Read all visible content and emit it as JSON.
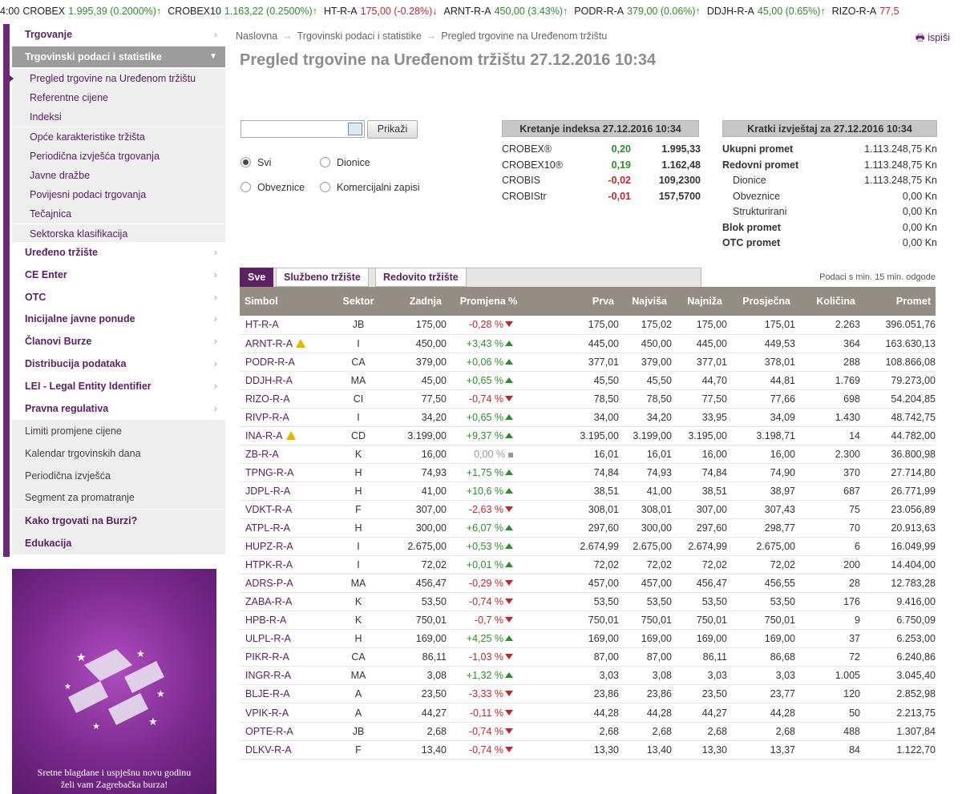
{
  "ticker": [
    {
      "text": "4:00",
      "cls": ""
    },
    {
      "text": "CROBEX",
      "cls": ""
    },
    {
      "text": "1.995,39 (0.2000%)↑",
      "cls": "up"
    },
    {
      "text": "CROBEX10",
      "cls": ""
    },
    {
      "text": "1.163,22 (0.2500%)↑",
      "cls": "up"
    },
    {
      "text": "HT-R-A",
      "cls": ""
    },
    {
      "text": "175,00 (-0.28%)↓",
      "cls": "dn"
    },
    {
      "text": "ARNT-R-A",
      "cls": ""
    },
    {
      "text": "450,00 (3.43%)↑",
      "cls": "up"
    },
    {
      "text": "PODR-R-A",
      "cls": ""
    },
    {
      "text": "379,00 (0.06%)↑",
      "cls": "up"
    },
    {
      "text": "DDJH-R-A",
      "cls": ""
    },
    {
      "text": "45,00 (0.65%)↑",
      "cls": "up"
    },
    {
      "text": "RIZO-R-A",
      "cls": ""
    },
    {
      "text": "77,5",
      "cls": "dn"
    }
  ],
  "sidebar": {
    "trgovanje": "Trgovanje",
    "podaci": "Trgovinski podaci i statistike",
    "subitems": [
      "Pregled trgovine na Uređenom tržištu",
      "Referentne cijene",
      "Indeksi",
      "Opće karakteristike tržišta",
      "Periodična izvješća trgovanja",
      "Javne dražbe",
      "Povijesni podaci trgovanja",
      "Tečajnica",
      "Sektorska klasifikacija"
    ],
    "items": [
      "Uređeno tržište",
      "CE Enter",
      "OTC",
      "Inicijalne javne ponude",
      "Članovi Burze",
      "Distribucija podataka",
      "LEI - Legal Entity Identifier",
      "Pravna regulativa"
    ],
    "plain": [
      "Limiti promjene cijene",
      "Kalendar trgovinskih dana",
      "Periodična izvješća",
      "Segment za promatranje"
    ],
    "bottom": [
      "Kako trgovati na Burzi?",
      "Edukacija"
    ],
    "promo_line1": "Sretne blagdane i uspješnu novu godinu",
    "promo_line2": "želi vam Zagrebačka burza!"
  },
  "breadcrumb": [
    "Naslovna",
    "Trgovinski podaci i statistike",
    "Pregled trgovine na Uređenom tržištu"
  ],
  "print_label": "ispiši",
  "title": "Pregled trgovine na Uređenom tržištu 27.12.2016 10:34",
  "form": {
    "date_value": "",
    "show_button": "Prikaži",
    "radios": [
      "Svi",
      "Dionice",
      "Obveznice",
      "Komercijalni zapisi"
    ]
  },
  "index_box": {
    "header": "Kretanje indeksa 27.12.2016 10:34",
    "rows": [
      {
        "name": "CROBEX®",
        "change": "0,20",
        "value": "1.995,33",
        "sign": "pos"
      },
      {
        "name": "CROBEX10®",
        "change": "0,19",
        "value": "1.162,48",
        "sign": "pos"
      },
      {
        "name": "CROBIS",
        "change": "-0,02",
        "value": "109,2300",
        "sign": "neg"
      },
      {
        "name": "CROBIStr",
        "change": "-0,01",
        "value": "157,5700",
        "sign": "neg"
      }
    ]
  },
  "report_box": {
    "header": "Kratki izvještaj za 27.12.2016 10:34",
    "rows": [
      {
        "label": "Ukupni promet",
        "value": "1.113.248,75 Kn",
        "style": "b"
      },
      {
        "label": "Redovni promet",
        "value": "1.113.248,75 Kn",
        "style": "b"
      },
      {
        "label": "Dionice",
        "value": "1.113.248,75 Kn",
        "style": "ind"
      },
      {
        "label": "Obveznice",
        "value": "0,00 Kn",
        "style": "ind"
      },
      {
        "label": "Strukturirani",
        "value": "0,00 Kn",
        "style": "ind"
      },
      {
        "label": "Blok promet",
        "value": "0,00 Kn",
        "style": "b"
      },
      {
        "label": "OTC promet",
        "value": "0,00 Kn",
        "style": "b"
      }
    ]
  },
  "tabs": [
    "Sve",
    "Službeno tržište",
    "Redovito tržište"
  ],
  "delay_note": "Podaci s min. 15 min. odgode",
  "table": {
    "headers": [
      "Simbol",
      "Sektor",
      "Zadnja",
      "Promjena %",
      "Prva",
      "Najviša",
      "Najniža",
      "Prosječna",
      "Količina",
      "Promet"
    ],
    "rows": [
      {
        "sym": "HT-R-A",
        "warn": false,
        "sec": "JB",
        "last": "175,00",
        "chg": "-0,28 %",
        "dir": "dn",
        "first": "175,00",
        "hi": "175,02",
        "lo": "175,00",
        "avg": "175,01",
        "qty": "2.263",
        "turn": "396.051,76"
      },
      {
        "sym": "ARNT-R-A",
        "warn": true,
        "sec": "I",
        "last": "450,00",
        "chg": "+3,43 %",
        "dir": "up",
        "first": "445,00",
        "hi": "450,00",
        "lo": "445,00",
        "avg": "449,53",
        "qty": "364",
        "turn": "163.630,13"
      },
      {
        "sym": "PODR-R-A",
        "warn": false,
        "sec": "CA",
        "last": "379,00",
        "chg": "+0,06 %",
        "dir": "up",
        "first": "377,01",
        "hi": "379,00",
        "lo": "377,01",
        "avg": "378,01",
        "qty": "288",
        "turn": "108.866,08"
      },
      {
        "sym": "DDJH-R-A",
        "warn": false,
        "sec": "MA",
        "last": "45,00",
        "chg": "+0,65 %",
        "dir": "up",
        "first": "45,50",
        "hi": "45,50",
        "lo": "44,70",
        "avg": "44,81",
        "qty": "1.769",
        "turn": "79.273,00"
      },
      {
        "sym": "RIZO-R-A",
        "warn": false,
        "sec": "CI",
        "last": "77,50",
        "chg": "-0,74 %",
        "dir": "dn",
        "first": "78,50",
        "hi": "78,50",
        "lo": "77,50",
        "avg": "77,66",
        "qty": "698",
        "turn": "54.204,85"
      },
      {
        "sym": "RIVP-R-A",
        "warn": false,
        "sec": "I",
        "last": "34,20",
        "chg": "+0,65 %",
        "dir": "up",
        "first": "34,00",
        "hi": "34,20",
        "lo": "33,95",
        "avg": "34,09",
        "qty": "1.430",
        "turn": "48.742,75"
      },
      {
        "sym": "INA-R-A",
        "warn": true,
        "sec": "CD",
        "last": "3.199,00",
        "chg": "+9,37 %",
        "dir": "up",
        "first": "3.195,00",
        "hi": "3.199,00",
        "lo": "3.195,00",
        "avg": "3.198,71",
        "qty": "14",
        "turn": "44.782,00"
      },
      {
        "sym": "ZB-R-A",
        "warn": false,
        "sec": "K",
        "last": "16,00",
        "chg": "0,00 %",
        "dir": "eq",
        "first": "16,01",
        "hi": "16,01",
        "lo": "16,00",
        "avg": "16,00",
        "qty": "2.300",
        "turn": "36.800,98"
      },
      {
        "sym": "TPNG-R-A",
        "warn": false,
        "sec": "H",
        "last": "74,93",
        "chg": "+1,75 %",
        "dir": "up",
        "first": "74,84",
        "hi": "74,93",
        "lo": "74,84",
        "avg": "74,90",
        "qty": "370",
        "turn": "27.714,80"
      },
      {
        "sym": "JDPL-R-A",
        "warn": false,
        "sec": "H",
        "last": "41,00",
        "chg": "+10,6 %",
        "dir": "up",
        "first": "38,51",
        "hi": "41,00",
        "lo": "38,51",
        "avg": "38,97",
        "qty": "687",
        "turn": "26.771,99"
      },
      {
        "sym": "VDKT-R-A",
        "warn": false,
        "sec": "F",
        "last": "307,00",
        "chg": "-2,63 %",
        "dir": "dn",
        "first": "308,01",
        "hi": "308,01",
        "lo": "307,00",
        "avg": "307,43",
        "qty": "75",
        "turn": "23.056,89"
      },
      {
        "sym": "ATPL-R-A",
        "warn": false,
        "sec": "H",
        "last": "300,00",
        "chg": "+6,07 %",
        "dir": "up",
        "first": "297,60",
        "hi": "300,00",
        "lo": "297,60",
        "avg": "298,77",
        "qty": "70",
        "turn": "20.913,63"
      },
      {
        "sym": "HUPZ-R-A",
        "warn": false,
        "sec": "I",
        "last": "2.675,00",
        "chg": "+0,53 %",
        "dir": "up",
        "first": "2.674,99",
        "hi": "2.675,00",
        "lo": "2.674,99",
        "avg": "2.675,00",
        "qty": "6",
        "turn": "16.049,99"
      },
      {
        "sym": "HTPK-R-A",
        "warn": false,
        "sec": "I",
        "last": "72,02",
        "chg": "+0,01 %",
        "dir": "up",
        "first": "72,02",
        "hi": "72,02",
        "lo": "72,02",
        "avg": "72,02",
        "qty": "200",
        "turn": "14.404,00"
      },
      {
        "sym": "ADRS-P-A",
        "warn": false,
        "sec": "MA",
        "last": "456,47",
        "chg": "-0,29 %",
        "dir": "dn",
        "first": "457,00",
        "hi": "457,00",
        "lo": "456,47",
        "avg": "456,55",
        "qty": "28",
        "turn": "12.783,28"
      },
      {
        "sym": "ZABA-R-A",
        "warn": false,
        "sec": "K",
        "last": "53,50",
        "chg": "-0,74 %",
        "dir": "dn",
        "first": "53,50",
        "hi": "53,50",
        "lo": "53,50",
        "avg": "53,50",
        "qty": "176",
        "turn": "9.416,00"
      },
      {
        "sym": "HPB-R-A",
        "warn": false,
        "sec": "K",
        "last": "750,01",
        "chg": "-0,7 %",
        "dir": "dn",
        "first": "750,01",
        "hi": "750,01",
        "lo": "750,01",
        "avg": "750,01",
        "qty": "9",
        "turn": "6.750,09"
      },
      {
        "sym": "ULPL-R-A",
        "warn": false,
        "sec": "H",
        "last": "169,00",
        "chg": "+4,25 %",
        "dir": "up",
        "first": "169,00",
        "hi": "169,00",
        "lo": "169,00",
        "avg": "169,00",
        "qty": "37",
        "turn": "6.253,00"
      },
      {
        "sym": "PIKR-R-A",
        "warn": false,
        "sec": "CA",
        "last": "86,11",
        "chg": "-1,03 %",
        "dir": "dn",
        "first": "87,00",
        "hi": "87,00",
        "lo": "86,11",
        "avg": "86,68",
        "qty": "72",
        "turn": "6.240,86"
      },
      {
        "sym": "INGR-R-A",
        "warn": false,
        "sec": "MA",
        "last": "3,08",
        "chg": "+1,32 %",
        "dir": "up",
        "first": "3,03",
        "hi": "3,08",
        "lo": "3,03",
        "avg": "3,03",
        "qty": "1.005",
        "turn": "3.045,40"
      },
      {
        "sym": "BLJE-R-A",
        "warn": false,
        "sec": "A",
        "last": "23,50",
        "chg": "-3,33 %",
        "dir": "dn",
        "first": "23,86",
        "hi": "23,86",
        "lo": "23,50",
        "avg": "23,77",
        "qty": "120",
        "turn": "2.852,98"
      },
      {
        "sym": "VPIK-R-A",
        "warn": false,
        "sec": "A",
        "last": "44,27",
        "chg": "-0,11 %",
        "dir": "dn",
        "first": "44,28",
        "hi": "44,28",
        "lo": "44,27",
        "avg": "44,28",
        "qty": "50",
        "turn": "2.213,75"
      },
      {
        "sym": "OPTE-R-A",
        "warn": false,
        "sec": "JB",
        "last": "2,68",
        "chg": "-0,74 %",
        "dir": "dn",
        "first": "2,68",
        "hi": "2,68",
        "lo": "2,68",
        "avg": "2,68",
        "qty": "488",
        "turn": "1.307,84"
      },
      {
        "sym": "DLKV-R-A",
        "warn": false,
        "sec": "F",
        "last": "13,40",
        "chg": "-0,74 %",
        "dir": "dn",
        "first": "13,30",
        "hi": "13,40",
        "lo": "13,30",
        "avg": "13,37",
        "qty": "84",
        "turn": "1.122,70"
      }
    ]
  }
}
